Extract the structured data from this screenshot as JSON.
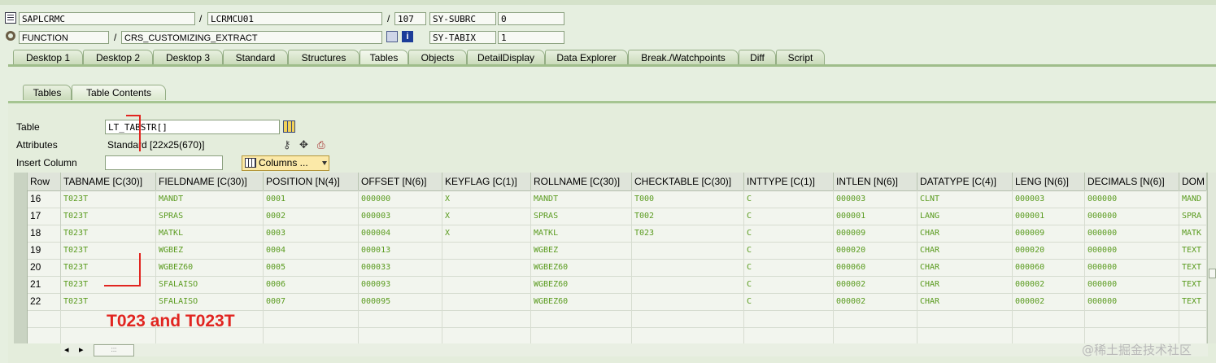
{
  "header": {
    "program": "SAPLCRMC",
    "include": "LCRMCU01",
    "line": "107",
    "subrc_label": "SY-SUBRC",
    "subrc_value": "0",
    "event_type": "FUNCTION",
    "event_name": "CRS_CUSTOMIZING_EXTRACT",
    "tabix_label": "SY-TABIX",
    "tabix_value": "1",
    "slash": "/"
  },
  "tabs": [
    {
      "label": "Desktop 1"
    },
    {
      "label": "Desktop 2"
    },
    {
      "label": "Desktop 3"
    },
    {
      "label": "Standard"
    },
    {
      "label": "Structures"
    },
    {
      "label": "Tables"
    },
    {
      "label": "Objects"
    },
    {
      "label": "DetailDisplay"
    },
    {
      "label": "Data Explorer"
    },
    {
      "label": "Break./Watchpoints"
    },
    {
      "label": "Diff"
    },
    {
      "label": "Script"
    }
  ],
  "subtabs": [
    {
      "label": "Tables"
    },
    {
      "label": "Table Contents"
    }
  ],
  "form": {
    "table_label": "Table",
    "table_value": "LT_TABSTR[]",
    "attributes_label": "Attributes",
    "attributes_value": "Standard [22x25(670)]",
    "insert_column_label": "Insert Column",
    "insert_column_value": "",
    "columns_button": "Columns ..."
  },
  "grid": {
    "columns": [
      "Row",
      "TABNAME [C(30)]",
      "FIELDNAME [C(30)]",
      "POSITION [N(4)]",
      "OFFSET [N(6)]",
      "KEYFLAG [C(1)]",
      "ROLLNAME [C(30)]",
      "CHECKTABLE [C(30)]",
      "INTTYPE [C(1)]",
      "INTLEN [N(6)]",
      "DATATYPE [C(4)]",
      "LENG [N(6)]",
      "DECIMALS [N(6)]",
      "DOM"
    ],
    "rows": [
      [
        "16",
        "T023T",
        "MANDT",
        "0001",
        "000000",
        "X",
        "MANDT",
        "T000",
        "C",
        "000003",
        "CLNT",
        "000003",
        "000000",
        "MAND"
      ],
      [
        "17",
        "T023T",
        "SPRAS",
        "0002",
        "000003",
        "X",
        "SPRAS",
        "T002",
        "C",
        "000001",
        "LANG",
        "000001",
        "000000",
        "SPRA"
      ],
      [
        "18",
        "T023T",
        "MATKL",
        "0003",
        "000004",
        "X",
        "MATKL",
        "T023",
        "C",
        "000009",
        "CHAR",
        "000009",
        "000000",
        "MATK"
      ],
      [
        "19",
        "T023T",
        "WGBEZ",
        "0004",
        "000013",
        "",
        "WGBEZ",
        "",
        "C",
        "000020",
        "CHAR",
        "000020",
        "000000",
        "TEXT"
      ],
      [
        "20",
        "T023T",
        "WGBEZ60",
        "0005",
        "000033",
        "",
        "WGBEZ60",
        "",
        "C",
        "000060",
        "CHAR",
        "000060",
        "000000",
        "TEXT"
      ],
      [
        "21",
        "T023T",
        "SFALAISO",
        "0006",
        "000093",
        "",
        "WGBEZ60",
        "",
        "C",
        "000002",
        "CHAR",
        "000002",
        "000000",
        "TEXT"
      ],
      [
        "22",
        "T023T",
        "SFALAISO",
        "0007",
        "000095",
        "",
        "WGBEZ60",
        "",
        "C",
        "000002",
        "CHAR",
        "000002",
        "000000",
        "TEXT"
      ]
    ]
  },
  "annotation": "T023 and T023T",
  "watermark": "@稀土掘金技术社区",
  "scroll": {
    "left_arrow": "◂",
    "right_arrow": "▸",
    "thumb": ":::"
  }
}
